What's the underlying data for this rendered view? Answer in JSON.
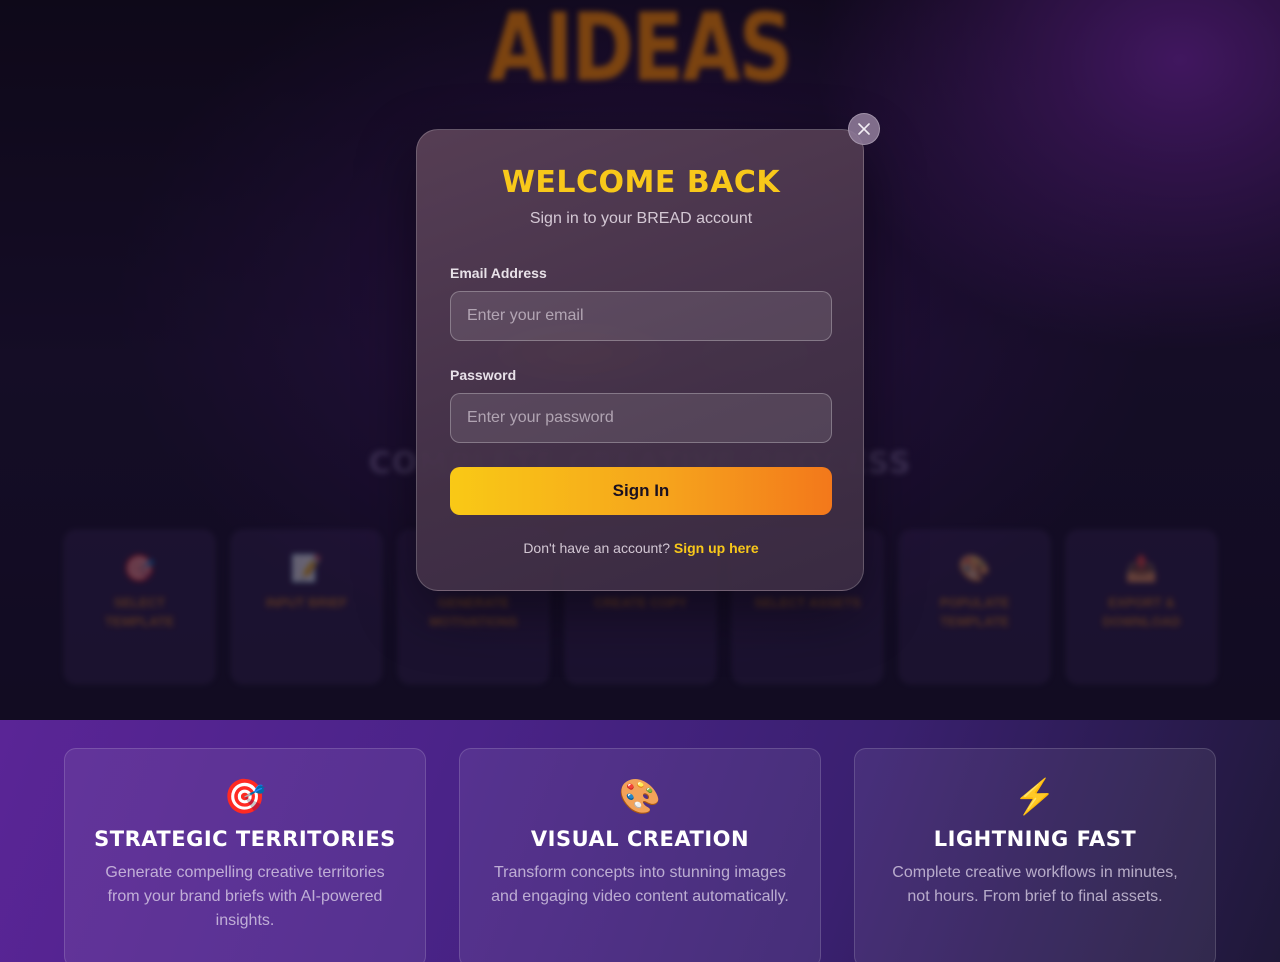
{
  "hero": {
    "logo": "AIDEAS",
    "process_title": "COMPLETE CREATIVE PROCESS",
    "steps": [
      {
        "icon": "🎯",
        "icon_name": "target-icon",
        "title": "SELECT TEMPLATE"
      },
      {
        "icon": "📝",
        "icon_name": "memo-icon",
        "title": "INPUT BRIEF"
      },
      {
        "icon": "",
        "icon_name": "",
        "title": "GENERATE MOTIVATIONS"
      },
      {
        "icon": "",
        "icon_name": "",
        "title": "CREATE COPY"
      },
      {
        "icon": "",
        "icon_name": "",
        "title": "SELECT ASSETS"
      },
      {
        "icon": "🎨",
        "icon_name": "palette-icon",
        "title": "POPULATE TEMPLATE"
      },
      {
        "icon": "📤",
        "icon_name": "outbox-icon",
        "title": "EXPORT & DOWNLOAD"
      }
    ]
  },
  "features": [
    {
      "icon": "🎯",
      "icon_name": "target-icon",
      "title": "STRATEGIC TERRITORIES",
      "description": "Generate compelling creative territories from your brand briefs with AI-powered insights."
    },
    {
      "icon": "🎨",
      "icon_name": "palette-icon",
      "title": "VISUAL CREATION",
      "description": "Transform concepts into stunning images and engaging video content automatically."
    },
    {
      "icon": "⚡",
      "icon_name": "lightning-icon",
      "title": "LIGHTNING FAST",
      "description": "Complete creative workflows in minutes, not hours. From brief to final assets."
    }
  ],
  "modal": {
    "title": "WELCOME BACK",
    "subtitle": "Sign in to your BREAD account",
    "email_label": "Email Address",
    "email_placeholder": "Enter your email",
    "email_value": "",
    "password_label": "Password",
    "password_placeholder": "Enter your password",
    "password_value": "",
    "submit_label": "Sign In",
    "signup_prompt": "Don't have an account?",
    "signup_link": "Sign up here",
    "close_icon": "close-icon"
  },
  "colors": {
    "accent_yellow": "#f8c81a",
    "accent_orange": "#f3781b",
    "feature_bg": "#4a2388"
  }
}
